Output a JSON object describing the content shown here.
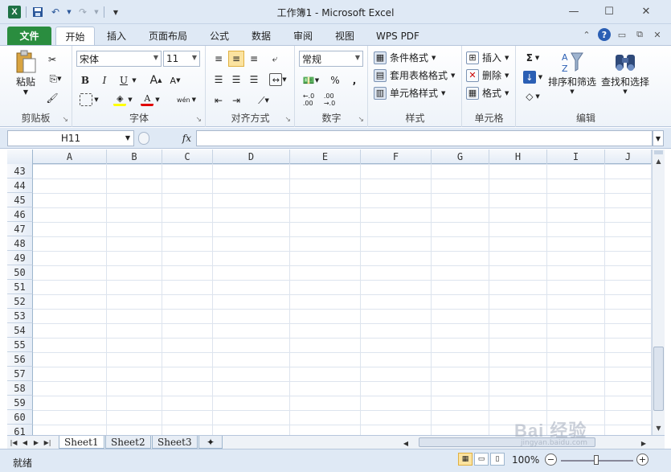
{
  "window": {
    "title": "工作簿1 - Microsoft Excel",
    "minimize": "—",
    "maximize": "☐",
    "close": "✕"
  },
  "quick_access": {
    "logo": "X",
    "icons": [
      "save-icon",
      "undo-icon",
      "redo-icon",
      "customize-icon"
    ]
  },
  "tabs": [
    {
      "label": "文件"
    },
    {
      "label": "开始"
    },
    {
      "label": "插入"
    },
    {
      "label": "页面布局"
    },
    {
      "label": "公式"
    },
    {
      "label": "数据"
    },
    {
      "label": "审阅"
    },
    {
      "label": "视图"
    },
    {
      "label": "WPS PDF"
    }
  ],
  "ribbon": {
    "clipboard": {
      "label": "剪贴板",
      "paste": "粘贴"
    },
    "font": {
      "label": "字体",
      "font_name": "宋体",
      "font_size": "11",
      "bold": "B",
      "italic": "I",
      "underline": "U",
      "grow": "A",
      "shrink": "A",
      "font_color": "A",
      "phonetic": "wén"
    },
    "alignment": {
      "label": "对齐方式"
    },
    "number": {
      "label": "数字",
      "format": "常规",
      "percent": "%",
      "comma": ","
    },
    "styles": {
      "label": "样式",
      "conditional": "条件格式",
      "table": "套用表格格式",
      "cell_styles": "单元格样式"
    },
    "cells": {
      "label": "单元格",
      "insert": "插入",
      "delete": "删除",
      "format": "格式"
    },
    "editing": {
      "label": "编辑",
      "sort_filter": "排序和筛选",
      "find_select": "查找和选择",
      "sigma": "Σ"
    }
  },
  "formula_bar": {
    "name_box": "H11",
    "fx": "fx",
    "value": ""
  },
  "grid": {
    "columns": [
      "A",
      "B",
      "C",
      "D",
      "E",
      "F",
      "G",
      "H",
      "I",
      "J"
    ],
    "rows": [
      "43",
      "44",
      "45",
      "46",
      "47",
      "48",
      "49",
      "50",
      "51",
      "52",
      "53",
      "54",
      "55",
      "56",
      "57",
      "58",
      "59",
      "60",
      "61"
    ]
  },
  "sheets": [
    {
      "label": "Sheet1",
      "active": true
    },
    {
      "label": "Sheet2",
      "active": false
    },
    {
      "label": "Sheet3",
      "active": false
    }
  ],
  "status": {
    "ready": "就绪",
    "zoom": "100%",
    "zoom_out": "−",
    "zoom_in": "+"
  },
  "watermark": {
    "text": "Bai 经验",
    "sub": "jingyan.baidu.com"
  }
}
